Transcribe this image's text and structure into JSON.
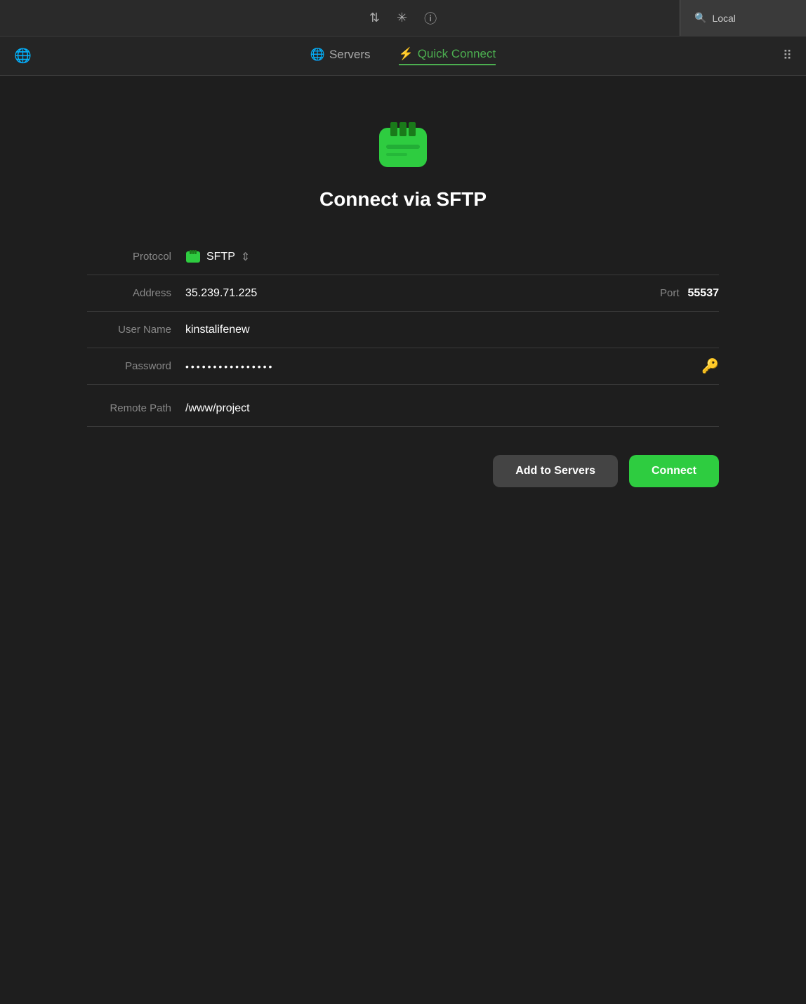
{
  "titlebar": {
    "transfer_icon": "⇅",
    "spinner_icon": "✳",
    "info_icon": "ⓘ",
    "search_placeholder": "Local",
    "search_prefix": "Q"
  },
  "tabs": {
    "servers_label": "Servers",
    "quick_connect_label": "Quick Connect",
    "lightning_symbol": "⚡"
  },
  "form": {
    "icon_alt": "SFTP connection icon",
    "connect_title": "Connect via SFTP",
    "protocol_label": "Protocol",
    "protocol_value": "SFTP",
    "address_label": "Address",
    "address_value": "35.239.71.225",
    "port_label": "Port",
    "port_value": "55537",
    "username_label": "User Name",
    "username_value": "kinstalifenew",
    "password_label": "Password",
    "password_value": "••••••••••••••••",
    "remote_path_label": "Remote Path",
    "remote_path_value": "/www/project"
  },
  "buttons": {
    "add_to_servers": "Add to Servers",
    "connect": "Connect"
  },
  "colors": {
    "green": "#2ecc40",
    "accent": "#4caf50",
    "dark_bg": "#1e1e1e",
    "tab_active": "#4caf50"
  }
}
